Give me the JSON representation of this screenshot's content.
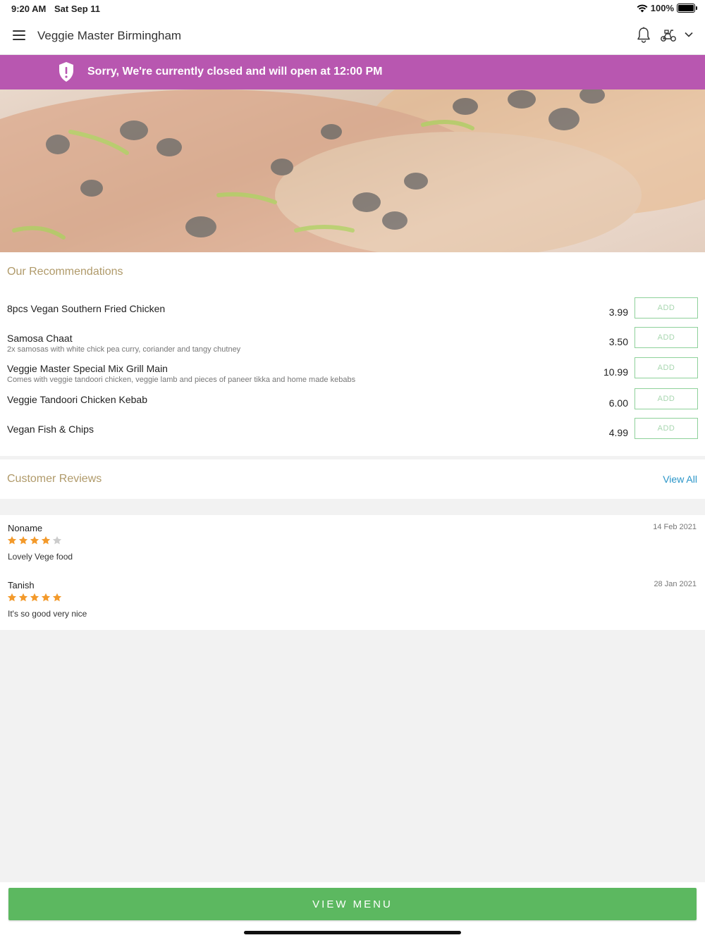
{
  "status_bar": {
    "time": "9:20 AM",
    "date": "Sat Sep 11",
    "battery": "100%",
    "battery_level": 1.0
  },
  "header": {
    "title": "Veggie Master Birmingham",
    "icons": [
      "menu-icon",
      "bell-icon",
      "scooter-icon",
      "chevron-down-icon"
    ]
  },
  "banner": {
    "text": "Sorry, We're currently closed and will open at 12:00 PM",
    "color": "#b857b0",
    "icon": "shield-alert-icon"
  },
  "recommendations": {
    "title": "Our Recommendations",
    "items": [
      {
        "name": "8pcs Vegan Southern Fried Chicken",
        "desc": "",
        "price": "3.99",
        "button": "ADD"
      },
      {
        "name": "Samosa Chaat",
        "desc": "2x samosas with white chick pea curry, coriander and tangy chutney",
        "price": "3.50",
        "button": "ADD"
      },
      {
        "name": "Veggie Master Special Mix Grill Main",
        "desc": "Comes with veggie tandoori chicken, veggie lamb and pieces of paneer tikka and home made kebabs",
        "price": "10.99",
        "button": "ADD"
      },
      {
        "name": "Veggie Tandoori Chicken Kebab",
        "desc": "",
        "price": "6.00",
        "button": "ADD"
      },
      {
        "name": "Vegan Fish & Chips",
        "desc": "",
        "price": "4.99",
        "button": "ADD"
      }
    ]
  },
  "reviews": {
    "title": "Customer Reviews",
    "view_all": "View All",
    "items": [
      {
        "name": "Noname",
        "date": "14 Feb 2021",
        "rating": 4,
        "text": "Lovely Vege food"
      },
      {
        "name": "Tanish",
        "date": "28 Jan 2021",
        "rating": 5,
        "text": "It's so good very nice"
      }
    ]
  },
  "footer": {
    "button": "VIEW MENU",
    "color": "#5cb860"
  },
  "colors": {
    "accent_gold": "#b09a6a",
    "link_blue": "#2a95c8",
    "star_orange": "#f39a2b",
    "star_empty": "#cccccc"
  }
}
